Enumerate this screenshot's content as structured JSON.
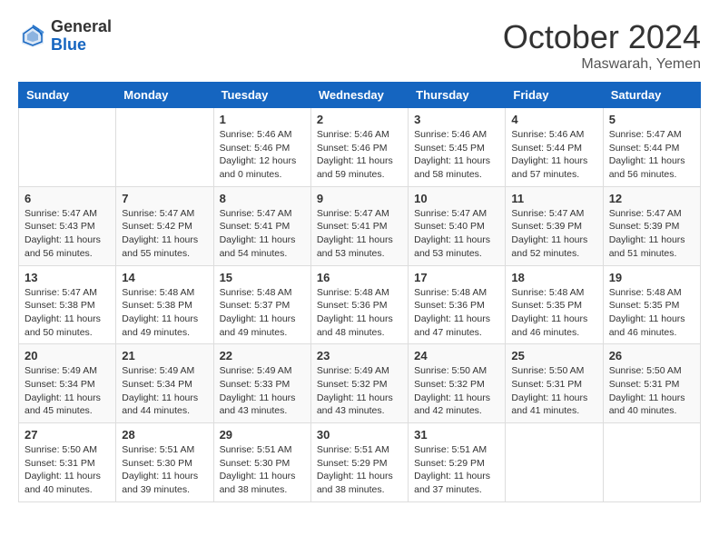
{
  "header": {
    "logo_general": "General",
    "logo_blue": "Blue",
    "month_title": "October 2024",
    "location": "Maswarah, Yemen"
  },
  "days_of_week": [
    "Sunday",
    "Monday",
    "Tuesday",
    "Wednesday",
    "Thursday",
    "Friday",
    "Saturday"
  ],
  "weeks": [
    [
      {
        "day": "",
        "sunrise": "",
        "sunset": "",
        "daylight": ""
      },
      {
        "day": "",
        "sunrise": "",
        "sunset": "",
        "daylight": ""
      },
      {
        "day": "1",
        "sunrise": "Sunrise: 5:46 AM",
        "sunset": "Sunset: 5:46 PM",
        "daylight": "Daylight: 12 hours and 0 minutes."
      },
      {
        "day": "2",
        "sunrise": "Sunrise: 5:46 AM",
        "sunset": "Sunset: 5:46 PM",
        "daylight": "Daylight: 11 hours and 59 minutes."
      },
      {
        "day": "3",
        "sunrise": "Sunrise: 5:46 AM",
        "sunset": "Sunset: 5:45 PM",
        "daylight": "Daylight: 11 hours and 58 minutes."
      },
      {
        "day": "4",
        "sunrise": "Sunrise: 5:46 AM",
        "sunset": "Sunset: 5:44 PM",
        "daylight": "Daylight: 11 hours and 57 minutes."
      },
      {
        "day": "5",
        "sunrise": "Sunrise: 5:47 AM",
        "sunset": "Sunset: 5:44 PM",
        "daylight": "Daylight: 11 hours and 56 minutes."
      }
    ],
    [
      {
        "day": "6",
        "sunrise": "Sunrise: 5:47 AM",
        "sunset": "Sunset: 5:43 PM",
        "daylight": "Daylight: 11 hours and 56 minutes."
      },
      {
        "day": "7",
        "sunrise": "Sunrise: 5:47 AM",
        "sunset": "Sunset: 5:42 PM",
        "daylight": "Daylight: 11 hours and 55 minutes."
      },
      {
        "day": "8",
        "sunrise": "Sunrise: 5:47 AM",
        "sunset": "Sunset: 5:41 PM",
        "daylight": "Daylight: 11 hours and 54 minutes."
      },
      {
        "day": "9",
        "sunrise": "Sunrise: 5:47 AM",
        "sunset": "Sunset: 5:41 PM",
        "daylight": "Daylight: 11 hours and 53 minutes."
      },
      {
        "day": "10",
        "sunrise": "Sunrise: 5:47 AM",
        "sunset": "Sunset: 5:40 PM",
        "daylight": "Daylight: 11 hours and 53 minutes."
      },
      {
        "day": "11",
        "sunrise": "Sunrise: 5:47 AM",
        "sunset": "Sunset: 5:39 PM",
        "daylight": "Daylight: 11 hours and 52 minutes."
      },
      {
        "day": "12",
        "sunrise": "Sunrise: 5:47 AM",
        "sunset": "Sunset: 5:39 PM",
        "daylight": "Daylight: 11 hours and 51 minutes."
      }
    ],
    [
      {
        "day": "13",
        "sunrise": "Sunrise: 5:47 AM",
        "sunset": "Sunset: 5:38 PM",
        "daylight": "Daylight: 11 hours and 50 minutes."
      },
      {
        "day": "14",
        "sunrise": "Sunrise: 5:48 AM",
        "sunset": "Sunset: 5:38 PM",
        "daylight": "Daylight: 11 hours and 49 minutes."
      },
      {
        "day": "15",
        "sunrise": "Sunrise: 5:48 AM",
        "sunset": "Sunset: 5:37 PM",
        "daylight": "Daylight: 11 hours and 49 minutes."
      },
      {
        "day": "16",
        "sunrise": "Sunrise: 5:48 AM",
        "sunset": "Sunset: 5:36 PM",
        "daylight": "Daylight: 11 hours and 48 minutes."
      },
      {
        "day": "17",
        "sunrise": "Sunrise: 5:48 AM",
        "sunset": "Sunset: 5:36 PM",
        "daylight": "Daylight: 11 hours and 47 minutes."
      },
      {
        "day": "18",
        "sunrise": "Sunrise: 5:48 AM",
        "sunset": "Sunset: 5:35 PM",
        "daylight": "Daylight: 11 hours and 46 minutes."
      },
      {
        "day": "19",
        "sunrise": "Sunrise: 5:48 AM",
        "sunset": "Sunset: 5:35 PM",
        "daylight": "Daylight: 11 hours and 46 minutes."
      }
    ],
    [
      {
        "day": "20",
        "sunrise": "Sunrise: 5:49 AM",
        "sunset": "Sunset: 5:34 PM",
        "daylight": "Daylight: 11 hours and 45 minutes."
      },
      {
        "day": "21",
        "sunrise": "Sunrise: 5:49 AM",
        "sunset": "Sunset: 5:34 PM",
        "daylight": "Daylight: 11 hours and 44 minutes."
      },
      {
        "day": "22",
        "sunrise": "Sunrise: 5:49 AM",
        "sunset": "Sunset: 5:33 PM",
        "daylight": "Daylight: 11 hours and 43 minutes."
      },
      {
        "day": "23",
        "sunrise": "Sunrise: 5:49 AM",
        "sunset": "Sunset: 5:32 PM",
        "daylight": "Daylight: 11 hours and 43 minutes."
      },
      {
        "day": "24",
        "sunrise": "Sunrise: 5:50 AM",
        "sunset": "Sunset: 5:32 PM",
        "daylight": "Daylight: 11 hours and 42 minutes."
      },
      {
        "day": "25",
        "sunrise": "Sunrise: 5:50 AM",
        "sunset": "Sunset: 5:31 PM",
        "daylight": "Daylight: 11 hours and 41 minutes."
      },
      {
        "day": "26",
        "sunrise": "Sunrise: 5:50 AM",
        "sunset": "Sunset: 5:31 PM",
        "daylight": "Daylight: 11 hours and 40 minutes."
      }
    ],
    [
      {
        "day": "27",
        "sunrise": "Sunrise: 5:50 AM",
        "sunset": "Sunset: 5:31 PM",
        "daylight": "Daylight: 11 hours and 40 minutes."
      },
      {
        "day": "28",
        "sunrise": "Sunrise: 5:51 AM",
        "sunset": "Sunset: 5:30 PM",
        "daylight": "Daylight: 11 hours and 39 minutes."
      },
      {
        "day": "29",
        "sunrise": "Sunrise: 5:51 AM",
        "sunset": "Sunset: 5:30 PM",
        "daylight": "Daylight: 11 hours and 38 minutes."
      },
      {
        "day": "30",
        "sunrise": "Sunrise: 5:51 AM",
        "sunset": "Sunset: 5:29 PM",
        "daylight": "Daylight: 11 hours and 38 minutes."
      },
      {
        "day": "31",
        "sunrise": "Sunrise: 5:51 AM",
        "sunset": "Sunset: 5:29 PM",
        "daylight": "Daylight: 11 hours and 37 minutes."
      },
      {
        "day": "",
        "sunrise": "",
        "sunset": "",
        "daylight": ""
      },
      {
        "day": "",
        "sunrise": "",
        "sunset": "",
        "daylight": ""
      }
    ]
  ]
}
